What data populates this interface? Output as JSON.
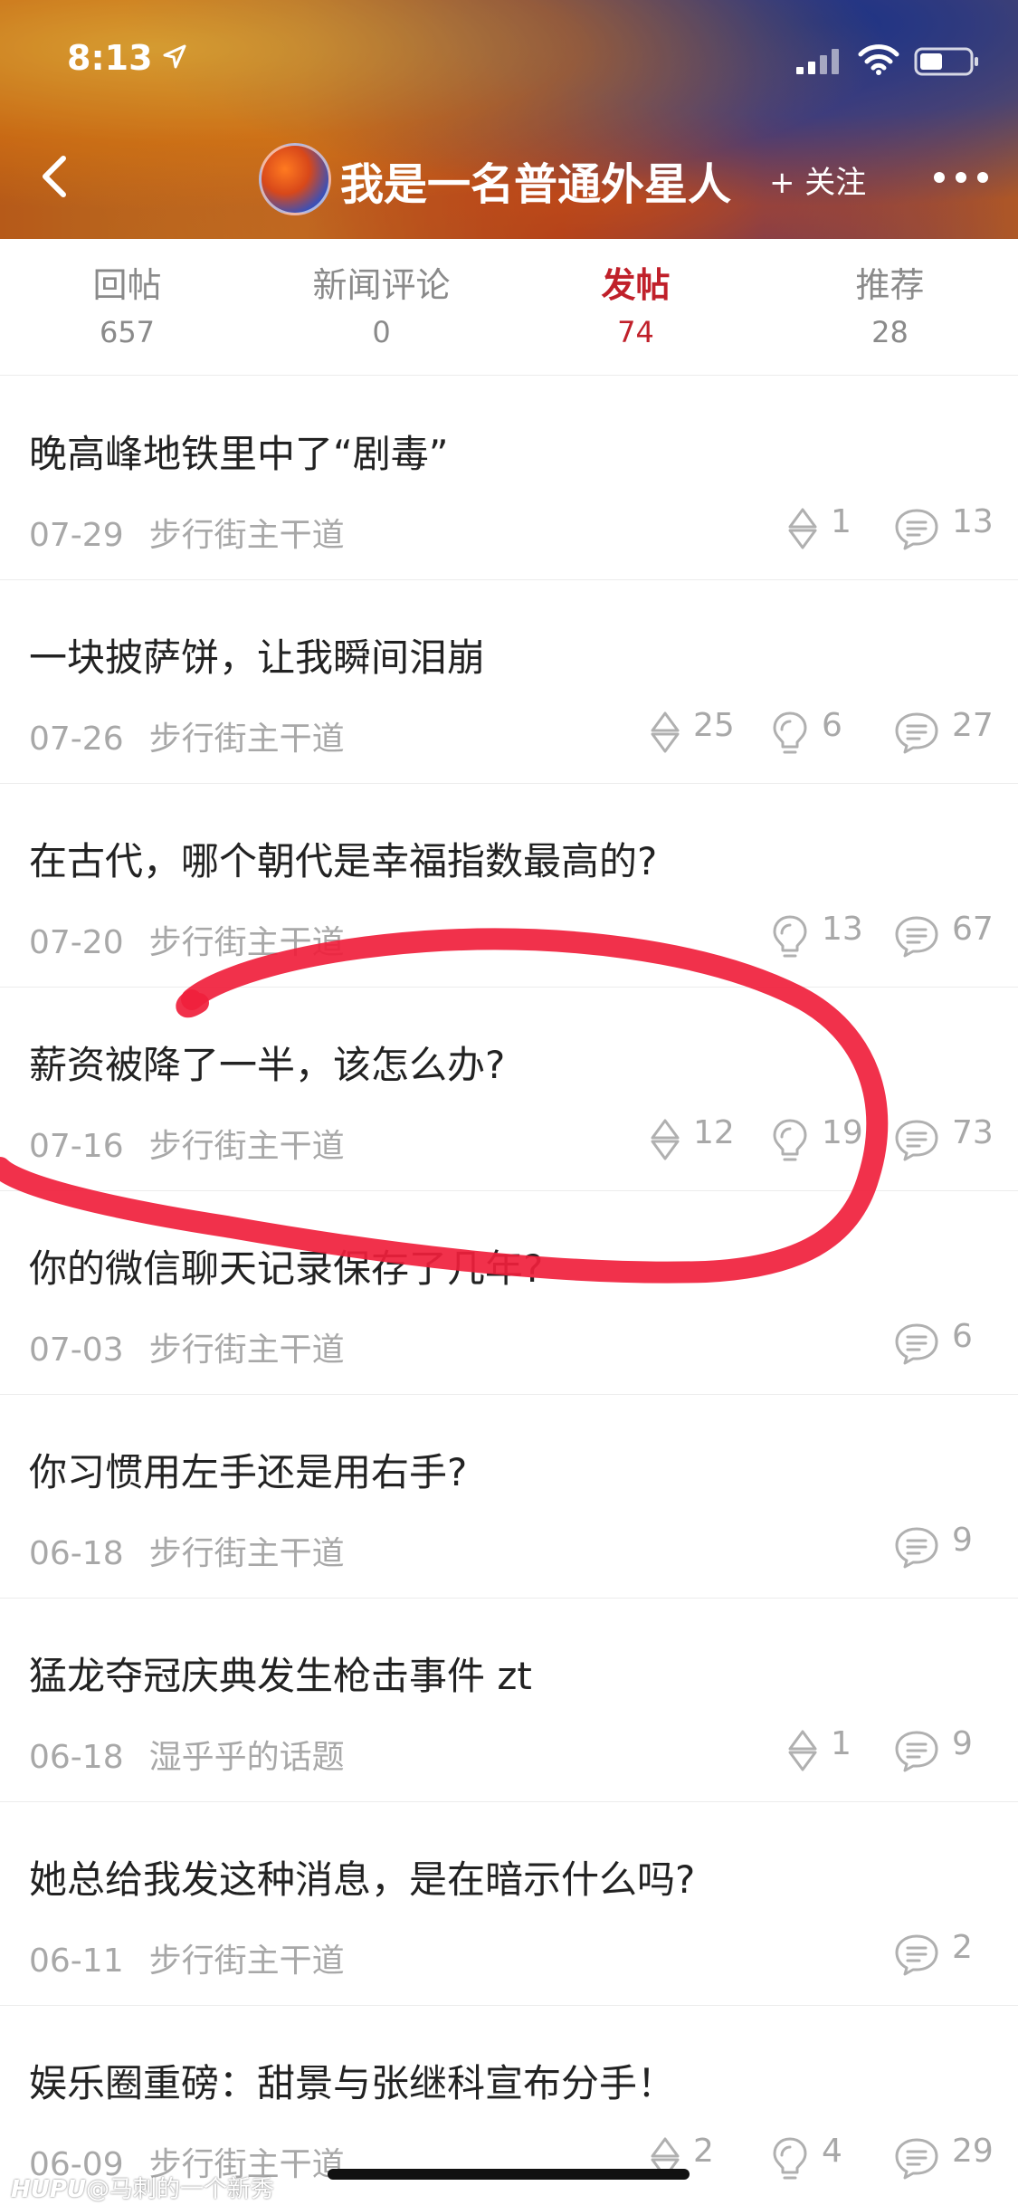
{
  "status_bar": {
    "time": "8:13"
  },
  "header": {
    "user_name": "我是一名普通外星人",
    "follow_label": "+ 关注"
  },
  "tabs": [
    {
      "label": "回帖",
      "count": "657"
    },
    {
      "label": "新闻评论",
      "count": "0"
    },
    {
      "label": "发帖",
      "count": "74"
    },
    {
      "label": "推荐",
      "count": "28"
    }
  ],
  "active_tab": "发帖",
  "accent_color": "#c0202a",
  "posts": [
    {
      "title": "晚高峰地铁里中了“剧毒”",
      "date": "07-29",
      "forum": "步行街主干道",
      "votes": "1",
      "lights": null,
      "replies": "13"
    },
    {
      "title": "一块披萨饼，让我瞬间泪崩",
      "date": "07-26",
      "forum": "步行街主干道",
      "votes": "25",
      "lights": "6",
      "replies": "27"
    },
    {
      "title": "在古代，哪个朝代是幸福指数最高的?",
      "date": "07-20",
      "forum": "步行街主干道",
      "votes": null,
      "lights": "13",
      "replies": "67"
    },
    {
      "title": "薪资被降了一半，该怎么办?",
      "date": "07-16",
      "forum": "步行街主干道",
      "votes": "12",
      "lights": "19",
      "replies": "73"
    },
    {
      "title": "你的微信聊天记录保存了几年?",
      "date": "07-03",
      "forum": "步行街主干道",
      "votes": null,
      "lights": null,
      "replies": "6"
    },
    {
      "title": "你习惯用左手还是用右手?",
      "date": "06-18",
      "forum": "步行街主干道",
      "votes": null,
      "lights": null,
      "replies": "9"
    },
    {
      "title": "猛龙夺冠庆典发生枪击事件 zt",
      "date": "06-18",
      "forum": "湿乎乎的话题",
      "votes": "1",
      "lights": null,
      "replies": "9"
    },
    {
      "title": "她总给我发这种消息，是在暗示什么吗?",
      "date": "06-11",
      "forum": "步行街主干道",
      "votes": null,
      "lights": null,
      "replies": "2"
    },
    {
      "title": "娱乐圈重磅：甜景与张继科宣布分手！",
      "date": "06-09",
      "forum": "步行街主干道",
      "votes": "2",
      "lights": "4",
      "replies": "29"
    }
  ],
  "icons": {
    "vote": "vote-icon",
    "light": "lightbulb-icon",
    "reply": "comment-icon"
  },
  "watermark": {
    "brand": "HUPU",
    "text": "@马刺的一个新秀"
  }
}
